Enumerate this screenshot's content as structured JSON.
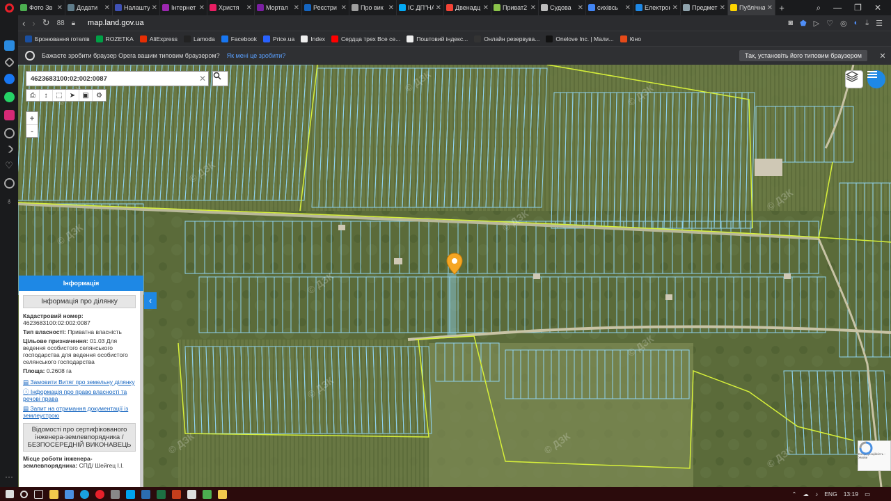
{
  "tabs": [
    {
      "label": "Фото Зв",
      "color": "#4caf50"
    },
    {
      "label": "Додати",
      "color": "#607d8b"
    },
    {
      "label": "Налашту",
      "color": "#3f51b5"
    },
    {
      "label": "Інтернет",
      "color": "#9c27b0"
    },
    {
      "label": "Христя",
      "color": "#e91e63"
    },
    {
      "label": "Мортал",
      "color": "#7b1fa2"
    },
    {
      "label": "Реєстри",
      "color": "#1565c0"
    },
    {
      "label": "Про вик",
      "color": "#9e9e9e"
    },
    {
      "label": "ІС ДП\"НА",
      "color": "#03a9f4"
    },
    {
      "label": "Двенадц",
      "color": "#f44336"
    },
    {
      "label": "Приват2",
      "color": "#8bc34a"
    },
    {
      "label": "Судова",
      "color": "#bdbdbd"
    },
    {
      "label": "сихівсь",
      "color": "#4285f4"
    },
    {
      "label": "Електрон",
      "color": "#1e88e5"
    },
    {
      "label": "Предмет",
      "color": "#90a4ae"
    },
    {
      "label": "Публічна",
      "color": "#ffd600",
      "active": true
    }
  ],
  "address": {
    "url": "map.land.gov.ua",
    "speed_dial": "88"
  },
  "bookmarks": [
    {
      "label": "Бронювання готелів",
      "color": "#1a4fa0"
    },
    {
      "label": "ROZETKA",
      "color": "#00a046"
    },
    {
      "label": "AliExpress",
      "color": "#e62e04"
    },
    {
      "label": "Lamoda",
      "color": "#222222"
    },
    {
      "label": "Facebook",
      "color": "#1877f2"
    },
    {
      "label": "Price.ua",
      "color": "#2962ff"
    },
    {
      "label": "Index",
      "color": "#eeeeee"
    },
    {
      "label": "Сердца трех Все се...",
      "color": "#ff0000"
    },
    {
      "label": "Поштовий індекс...",
      "color": "#eeeeee"
    },
    {
      "label": "Онлайн резервува...",
      "color": "#333333"
    },
    {
      "label": "Onelove Inc. | Мали...",
      "color": "#111111"
    },
    {
      "label": "Кіно",
      "color": "#e64a19"
    }
  ],
  "promo": {
    "text": "Бажаєте зробити браузер Opera вашим типовим браузером?",
    "link": "Як мені це зробити?",
    "button": "Так, установіть його типовим браузером"
  },
  "map": {
    "search_value": "4623683100:02:002:0087",
    "zoom_in": "+",
    "zoom_out": "-",
    "watermark": "ДЗК",
    "recaptcha_text": "Конфіденційність - Умови",
    "colors": {
      "parcel": "#8fd3f0",
      "boundary": "#d7f03a",
      "marker": "#f5a623",
      "accent": "#1e88e5"
    }
  },
  "panel": {
    "header": "Інформація",
    "title": "Інформація про ділянку",
    "cadastral_label": "Кадастровий номер:",
    "cadastral_value": "4623683100:02:002:0087",
    "ownership_label": "Тип власності:",
    "ownership_value": "Приватна власність",
    "purpose_label": "Цільове призначення:",
    "purpose_value": "01.03 Для ведення особистого селянського господарства для ведення особистого селянського господарства",
    "area_label": "Площа:",
    "area_value": "0.2608 га",
    "link_extract": "Замовити Витяг про земельну ділянку",
    "link_rights": "Інформація про право власності та речові права",
    "link_docs": "Запит на отримання документації із землеустрою",
    "cert_title": "Відомості про сертифікованого інженера-землевпорядника / БЕЗПОСЕРЕДНІЙ ВИКОНАВЕЦЬ",
    "work_label": "Місце роботи інженера-землевпорядника:",
    "work_value": "СПД/ Шейгец І.І."
  },
  "taskbar": {
    "lang": "ENG",
    "time": "13:19"
  }
}
